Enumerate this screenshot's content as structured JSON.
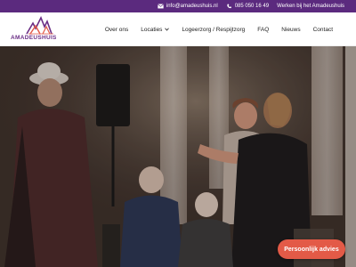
{
  "topbar": {
    "email": "info@amadeushuis.nl",
    "phone": "085 050 16 49",
    "jobs_link": "Werken bij het Amadeushuis"
  },
  "brand": {
    "name": "AMADEUSHUIS",
    "primary_color": "#5b2a7e",
    "accent_color": "#e35a47"
  },
  "nav": {
    "items": [
      {
        "label": "Over ons"
      },
      {
        "label": "Locaties"
      },
      {
        "label": "Logeerzorg / Respijtzorg"
      },
      {
        "label": "FAQ"
      },
      {
        "label": "Nieuws"
      },
      {
        "label": "Contact"
      }
    ]
  },
  "hero": {
    "image_icon": "photo-icon"
  },
  "cta": {
    "label": "Persoonlijk advies"
  }
}
